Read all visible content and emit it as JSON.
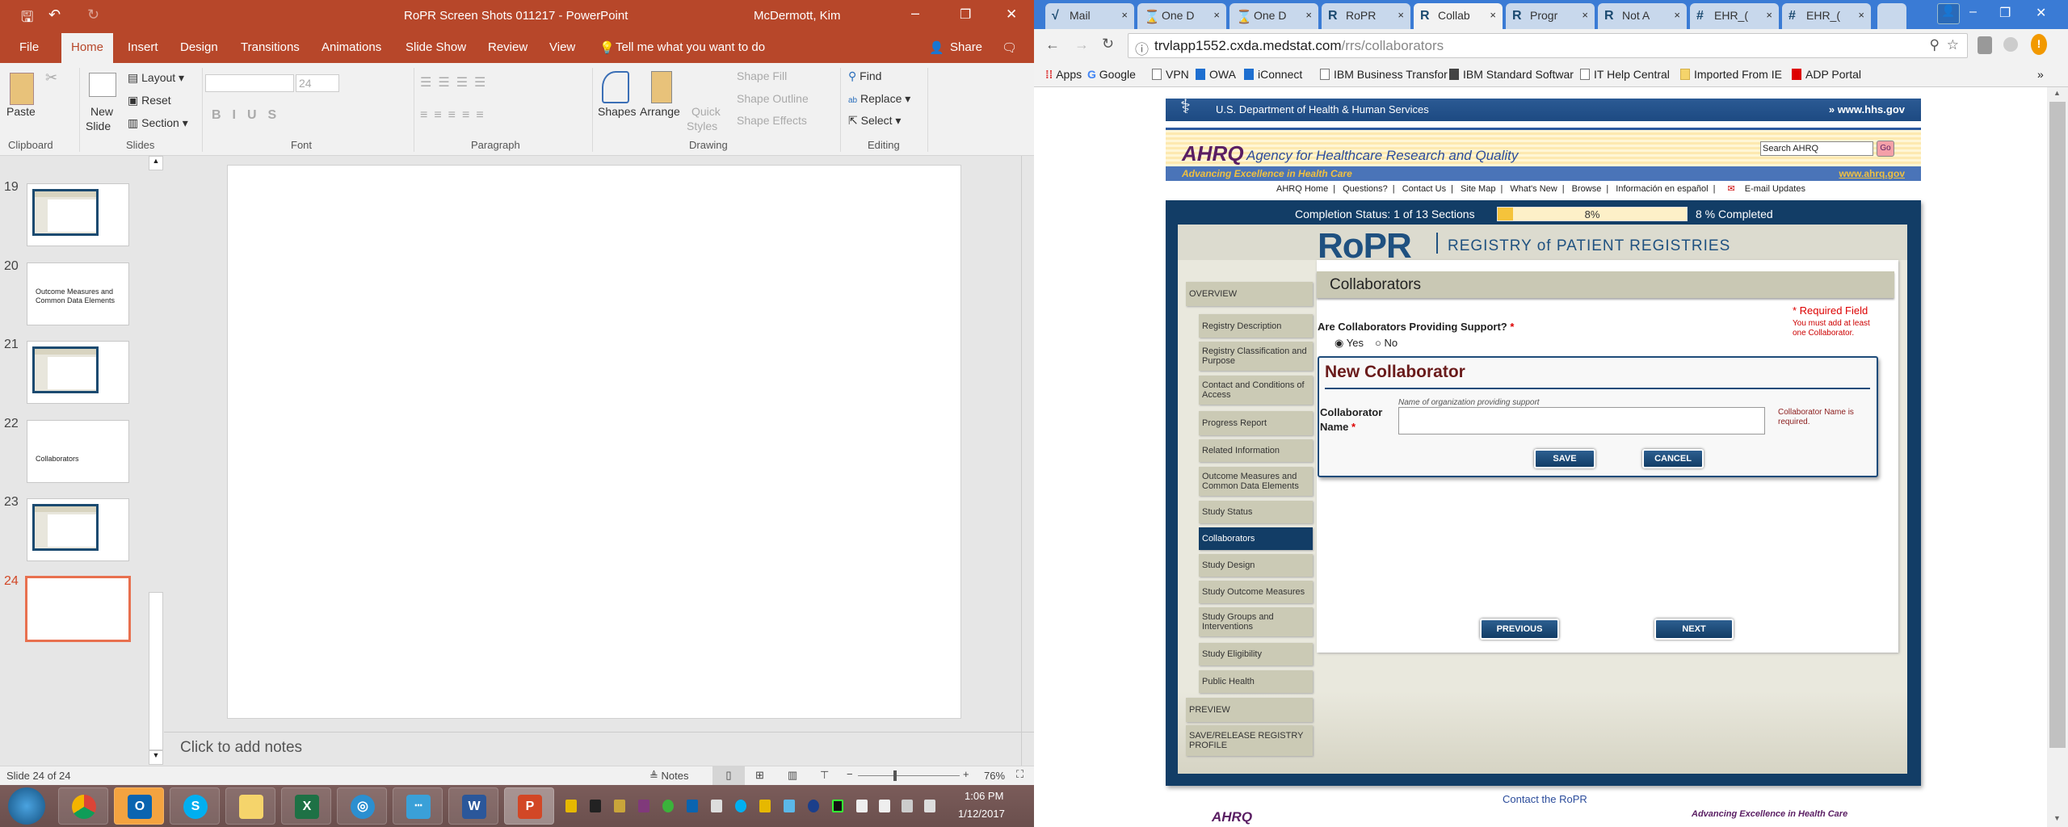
{
  "ppt": {
    "title": "RoPR Screen Shots 011217  -  PowerPoint",
    "user": "McDermott, Kim",
    "tabs": [
      "File",
      "Home",
      "Insert",
      "Design",
      "Transitions",
      "Animations",
      "Slide Show",
      "Review",
      "View"
    ],
    "tell_me": "Tell me what you want to do",
    "share": "Share",
    "ribbon": {
      "paste": "Paste",
      "new_slide": "New",
      "new_slide2": "Slide",
      "layout": "Layout",
      "reset": "Reset",
      "section": "Section",
      "font_size": "24",
      "shapes": "Shapes",
      "arrange": "Arrange",
      "quick": "Quick",
      "styles": "Styles",
      "shape_fill": "Shape Fill",
      "shape_outline": "Shape Outline",
      "shape_effects": "Shape Effects",
      "find": "Find",
      "replace": "Replace",
      "select": "Select",
      "groups": [
        "Clipboard",
        "Slides",
        "Font",
        "Paragraph",
        "Drawing",
        "Editing"
      ]
    },
    "thumbnails": [
      {
        "num": "19",
        "text": ""
      },
      {
        "num": "20",
        "text": "Outcome Measures and Common Data Elements"
      },
      {
        "num": "21",
        "text": ""
      },
      {
        "num": "22",
        "text": "Collaborators"
      },
      {
        "num": "23",
        "text": ""
      },
      {
        "num": "24",
        "text": ""
      }
    ],
    "notes_placeholder": "Click to add notes",
    "status": {
      "slide": "Slide 24 of 24",
      "notes": "Notes",
      "zoom": "76%"
    },
    "clock": {
      "time": "1:06 PM",
      "date": "1/12/2017"
    },
    "accent": "#b7472a"
  },
  "browser": {
    "tabs": [
      {
        "fav": "√",
        "label": "Mail"
      },
      {
        "fav": "⌛",
        "label": "One D"
      },
      {
        "fav": "⌛",
        "label": "One D"
      },
      {
        "fav": "R",
        "label": "RoPR"
      },
      {
        "fav": "R",
        "label": "Collab"
      },
      {
        "fav": "R",
        "label": "Progr"
      },
      {
        "fav": "R",
        "label": "Not A"
      },
      {
        "fav": "#",
        "label": "EHR_("
      },
      {
        "fav": "#",
        "label": "EHR_("
      }
    ],
    "url_host": "trvlapp1552.cxda.medstat.com",
    "url_path": "/rrs/collaborators",
    "bookmarks": [
      "Apps",
      "Google",
      "VPN",
      "OWA",
      "iConnect",
      "IBM Business Transfor",
      "IBM Standard Softwar",
      "IT Help Central",
      "Imported From IE",
      "ADP Portal"
    ]
  },
  "page": {
    "hhs": "U.S. Department of Health & Human Services",
    "hhs_url": "www.hhs.gov",
    "ahrq_logo": "AHRQ",
    "ahrq_name": "Agency for Healthcare Research and Quality",
    "ahrq_tagline": "Advancing Excellence in Health Care",
    "ahrq_url": "www.ahrq.gov",
    "search_placeholder": "Search AHRQ",
    "go": "Go",
    "links": [
      "AHRQ Home",
      "Questions?",
      "Contact Us",
      "Site Map",
      "What's New",
      "Browse",
      "Información en español",
      "E-mail Updates"
    ],
    "completion": {
      "label": "Completion Status: 1 of 13 Sections",
      "percent": 8,
      "bar_text": "8%",
      "completed": "8 % Completed"
    },
    "ropr_logo": "RoPR",
    "ropr_name": "REGISTRY of PATIENT REGISTRIES",
    "sidebar": [
      "OVERVIEW",
      "Registry Description",
      "Registry Classification and Purpose",
      "Contact and Conditions of Access",
      "Progress Report",
      "Related Information",
      "Outcome Measures and Common Data Elements",
      "Study Status",
      "Collaborators",
      "Study Design",
      "Study Outcome Measures",
      "Study Groups and Interventions",
      "Study Eligibility",
      "Public Health",
      "PREVIEW",
      "SAVE/RELEASE REGISTRY PROFILE"
    ],
    "section_title": "Collaborators",
    "required_field": "* Required Field",
    "question": "Are Collaborators Providing Support?",
    "yes": "Yes",
    "no": "No",
    "hint": "You must add at least one Collaborator.",
    "new_title": "New Collaborator",
    "name_label1": "Collaborator",
    "name_label2": "Name",
    "name_help": "Name of organization providing support",
    "name_error": "Collaborator Name is required.",
    "save": "SAVE",
    "cancel": "CANCEL",
    "previous": "PREVIOUS",
    "next": "NEXT",
    "contact": "Contact the RoPR",
    "footer_tagline": "Advancing Excellence in Health Care"
  }
}
